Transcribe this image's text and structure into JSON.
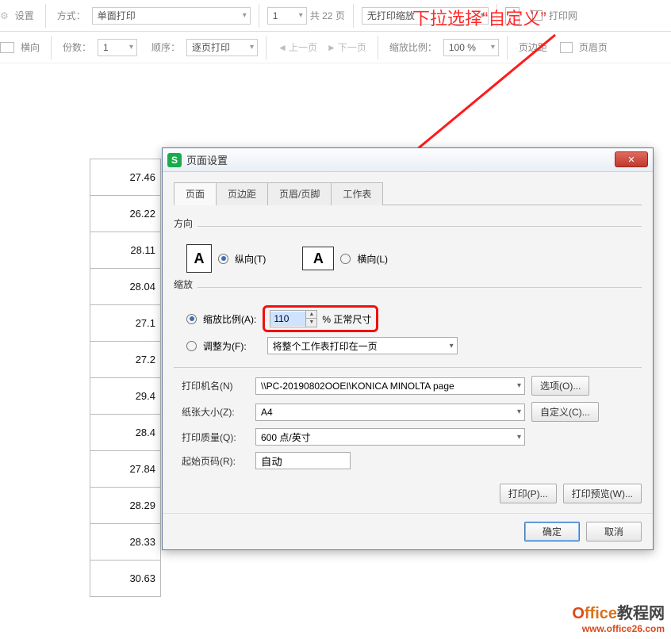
{
  "annotation": {
    "text": "下拉选择“自定义”"
  },
  "toolbar": {
    "settings": "设置",
    "orient": "横向",
    "mode_label": "方式：",
    "mode_value": "单面打印",
    "copies_label": "份数：",
    "copies_value": "1",
    "order_label": "顺序：",
    "order_value": "逐页打印",
    "page_no": "1",
    "page_total_label": "共 22 页",
    "prev": "上一页",
    "next": "下一页",
    "scale_sel": "无打印缩放",
    "scale_ratio_label": "缩放比例：",
    "scale_ratio_value": "100 %",
    "margin": "页边距",
    "header": "页眉页",
    "print_net": "打印网"
  },
  "left_numbers": [
    "27.46",
    "26.22",
    "28.11",
    "28.04",
    "27.1",
    "27.2",
    "29.4",
    "28.4",
    "27.84",
    "28.29",
    "28.33",
    "30.63"
  ],
  "dialog": {
    "title": "页面设置",
    "tabs": {
      "page": "页面",
      "margin": "页边距",
      "header": "页眉/页脚",
      "sheet": "工作表"
    },
    "section_direction": "方向",
    "portrait": "纵向(T)",
    "landscape": "横向(L)",
    "section_scale": "缩放",
    "scale_ratio_label": "缩放比例(A):",
    "scale_value": "110",
    "scale_suffix": "% 正常尺寸",
    "fit_label": "调整为(F):",
    "fit_value": "将整个工作表打印在一页",
    "printer_label": "打印机名(N)",
    "printer_value": "\\\\PC-20190802OOEI\\KONICA MINOLTA page",
    "options_btn": "选项(O)...",
    "paper_label": "纸张大小(Z):",
    "paper_value": "A4",
    "custom_btn": "自定义(C)...",
    "quality_label": "打印质量(Q):",
    "quality_value": "600 点/英寸",
    "startpage_label": "起始页码(R):",
    "startpage_value": "自动",
    "print_btn": "打印(P)...",
    "preview_btn": "打印预览(W)...",
    "ok_btn": "确定",
    "cancel_btn": "取消"
  },
  "watermark": {
    "line1a": "O",
    "line1b": "ffice",
    "line1c": "教程网",
    "line2": "www.office26.com"
  }
}
